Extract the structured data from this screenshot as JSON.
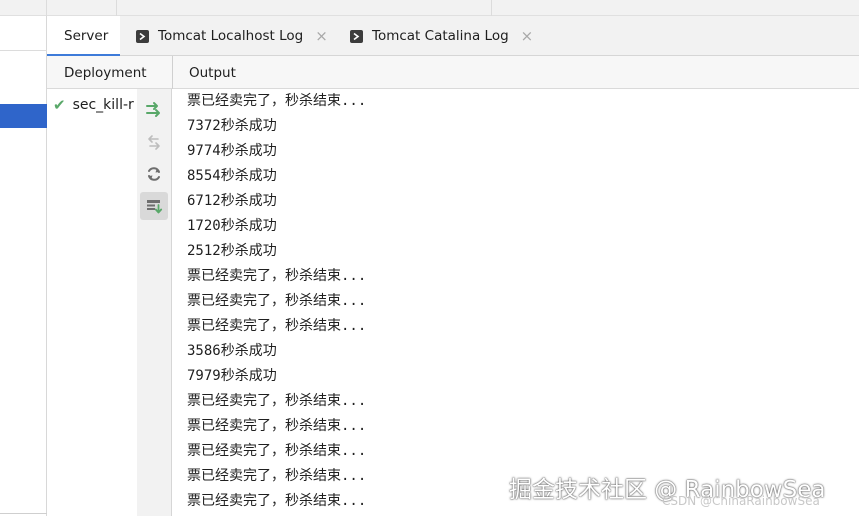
{
  "tabs": [
    {
      "label": "Server",
      "active": true,
      "closable": false,
      "icon": "none"
    },
    {
      "label": "Tomcat Localhost Log",
      "active": false,
      "closable": true,
      "icon": "terminal-icon"
    },
    {
      "label": "Tomcat Catalina Log",
      "active": false,
      "closable": true,
      "icon": "terminal-icon"
    }
  ],
  "tab_close_glyph": "×",
  "columns": {
    "deployment": "Deployment",
    "output": "Output"
  },
  "deployment_items": [
    {
      "label": "sec_kill-r",
      "status": "deployed",
      "status_icon": "check-icon"
    }
  ],
  "actions": [
    {
      "name": "deploy-all-icon",
      "enabled": true
    },
    {
      "name": "undeploy-icon",
      "enabled": false
    },
    {
      "name": "refresh-icon",
      "enabled": true
    },
    {
      "name": "scroll-to-end-icon",
      "enabled": true,
      "pressed": true
    }
  ],
  "output_lines": [
    "票已经卖完了，秒杀结束...",
    "7372秒杀成功",
    "9774秒杀成功",
    "8554秒杀成功",
    "6712秒杀成功",
    "1720秒杀成功",
    "2512秒杀成功",
    "票已经卖完了，秒杀结束...",
    "票已经卖完了，秒杀结束...",
    "票已经卖完了，秒杀结束...",
    "3586秒杀成功",
    "7979秒杀成功",
    "票已经卖完了，秒杀结束...",
    "票已经卖完了，秒杀结束...",
    "票已经卖完了，秒杀结束...",
    "票已经卖完了，秒杀结束...",
    "票已经卖完了，秒杀结束..."
  ],
  "watermark": {
    "main": "掘金技术社区 @ RainbowSea",
    "sub": "CSDN @ChinaRainbowSea"
  },
  "colors": {
    "accent": "#3d7bd9",
    "selection": "#2f65ca",
    "success": "#59a869"
  }
}
